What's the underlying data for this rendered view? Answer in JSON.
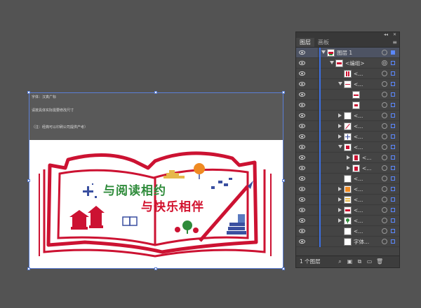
{
  "artboard": {
    "notes": [
      "字体：汉真广标",
      "请按具体实际需要修改尺寸",
      "（注：经典可以印刷公司提供产考）"
    ],
    "title_line1": "与阅读相约",
    "title_line2": "与快乐相伴"
  },
  "panel": {
    "tabs": [
      "图层",
      "画板"
    ],
    "menu_icon": "panel-menu-icon",
    "layer_count": "1 个图层",
    "rows": [
      {
        "name": "图层 1",
        "indent": 1,
        "expand": "down",
        "thumb": "layer",
        "selected": true,
        "top": true
      },
      {
        "name": "<编组>",
        "indent": 2,
        "expand": "down",
        "thumb": "group"
      },
      {
        "name": "<...",
        "indent": 3,
        "expand": "none",
        "thumb": "red-bar"
      },
      {
        "name": "<...",
        "indent": 3,
        "expand": "down",
        "thumb": "red-line"
      },
      {
        "name": "",
        "indent": 4,
        "expand": "none",
        "thumb": "red-dash"
      },
      {
        "name": "",
        "indent": 4,
        "expand": "none",
        "thumb": "red-dash2"
      },
      {
        "name": "<...",
        "indent": 3,
        "expand": "right",
        "thumb": "blank"
      },
      {
        "name": "<...",
        "indent": 3,
        "expand": "right",
        "thumb": "diag"
      },
      {
        "name": "<...",
        "indent": 3,
        "expand": "right",
        "thumb": "cross"
      },
      {
        "name": "<...",
        "indent": 3,
        "expand": "down",
        "thumb": "red-sq"
      },
      {
        "name": "<...",
        "indent": 4,
        "expand": "right",
        "thumb": "red-fig"
      },
      {
        "name": "<...",
        "indent": 4,
        "expand": "right",
        "thumb": "red-fig2"
      },
      {
        "name": "<...",
        "indent": 3,
        "expand": "none",
        "thumb": "blank"
      },
      {
        "name": "<...",
        "indent": 3,
        "expand": "right",
        "thumb": "orange"
      },
      {
        "name": "<...",
        "indent": 3,
        "expand": "right",
        "thumb": "stripes"
      },
      {
        "name": "<...",
        "indent": 3,
        "expand": "right",
        "thumb": "red-wave"
      },
      {
        "name": "<...",
        "indent": 3,
        "expand": "right",
        "thumb": "green"
      },
      {
        "name": "<...",
        "indent": 3,
        "expand": "none",
        "thumb": "blank"
      },
      {
        "name": "字体...",
        "indent": 3,
        "expand": "none",
        "thumb": "blank"
      }
    ]
  },
  "colors": {
    "accent_blue": "#3c6fe0",
    "frame_red": "#cc1232",
    "title_green": "#2e8b3a",
    "title_red": "#d2122e"
  }
}
